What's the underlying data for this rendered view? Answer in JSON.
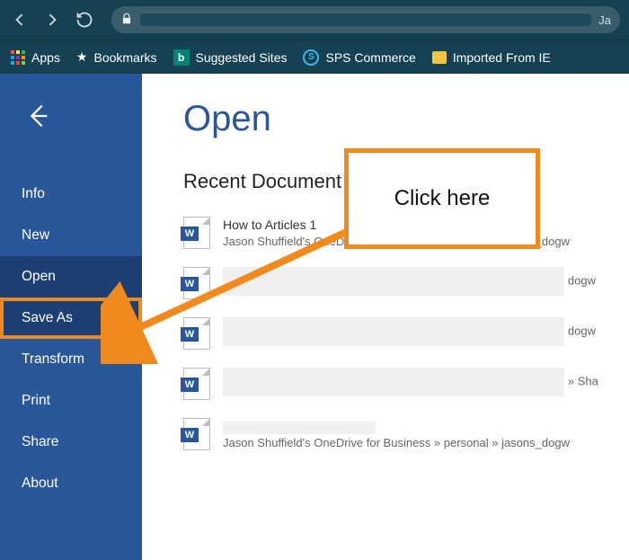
{
  "browser": {
    "addr_tail": "Ja",
    "bookmarks": {
      "apps": "Apps",
      "bookmarks": "Bookmarks",
      "suggested": "Suggested Sites",
      "sps": "SPS Commerce",
      "imported": "Imported From IE"
    }
  },
  "sidebar": {
    "items": {
      "info": "Info",
      "new": "New",
      "open": "Open",
      "save_as": "Save As",
      "transform": "Transform",
      "print": "Print",
      "share": "Share",
      "about": "About"
    }
  },
  "page": {
    "title": "Open",
    "section": "Recent Document"
  },
  "docs": [
    {
      "name": "How to Articles 1",
      "path": "Jason Shuffield's OneDrive for Business » personal » jasons_dogw"
    },
    {
      "tail": "dogw"
    },
    {
      "tail": "dogw"
    },
    {
      "tail": "» Sha"
    },
    {
      "path_visible": "Jason Shuffield's OneDrive for Business » personal » jasons_dogw"
    }
  ],
  "callout": {
    "text": "Click here"
  }
}
